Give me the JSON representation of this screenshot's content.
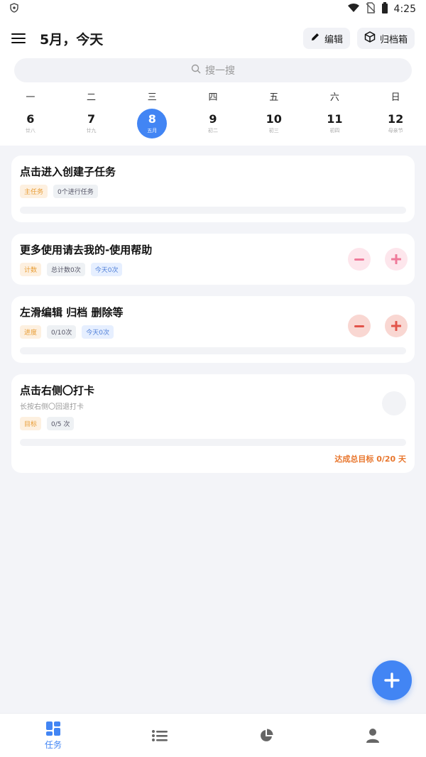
{
  "status": {
    "time": "4:25"
  },
  "header": {
    "title": "5月，今天",
    "edit_label": "编辑",
    "archive_label": "归档箱"
  },
  "search": {
    "placeholder": "搜一搜"
  },
  "calendar": {
    "weekdays": [
      "一",
      "二",
      "三",
      "四",
      "五",
      "六",
      "日"
    ],
    "dates": [
      {
        "day": "6",
        "lunar": "廿八"
      },
      {
        "day": "7",
        "lunar": "廿九"
      },
      {
        "day": "8",
        "lunar": "五月"
      },
      {
        "day": "9",
        "lunar": "初二"
      },
      {
        "day": "10",
        "lunar": "初三"
      },
      {
        "day": "11",
        "lunar": "初四"
      },
      {
        "day": "12",
        "lunar": "母亲节"
      }
    ],
    "selected_index": 2
  },
  "tasks": [
    {
      "title": "点击进入创建子任务",
      "tags": [
        "主任务",
        "0个进行任务"
      ]
    },
    {
      "title": "更多使用请去我的-使用帮助",
      "tags": [
        "计数",
        "总计数0次",
        "今天0次"
      ]
    },
    {
      "title": "左滑编辑 归档 删除等",
      "tags": [
        "进度",
        "0/10次",
        "今天0次"
      ]
    },
    {
      "title": "点击右侧〇打卡",
      "subtitle": "长按右侧〇回退打卡",
      "tags": [
        "目标",
        "0/5 次"
      ],
      "goal_text": "达成总目标 0/20 天"
    }
  ],
  "bottom_nav": {
    "tasks_label": "任务"
  },
  "colors": {
    "accent": "#4285f4",
    "tag_orange": "#e89c33",
    "goal_orange": "#e8762d",
    "minus_red": "#e2544a",
    "plus_pink": "#ef7a9a"
  }
}
